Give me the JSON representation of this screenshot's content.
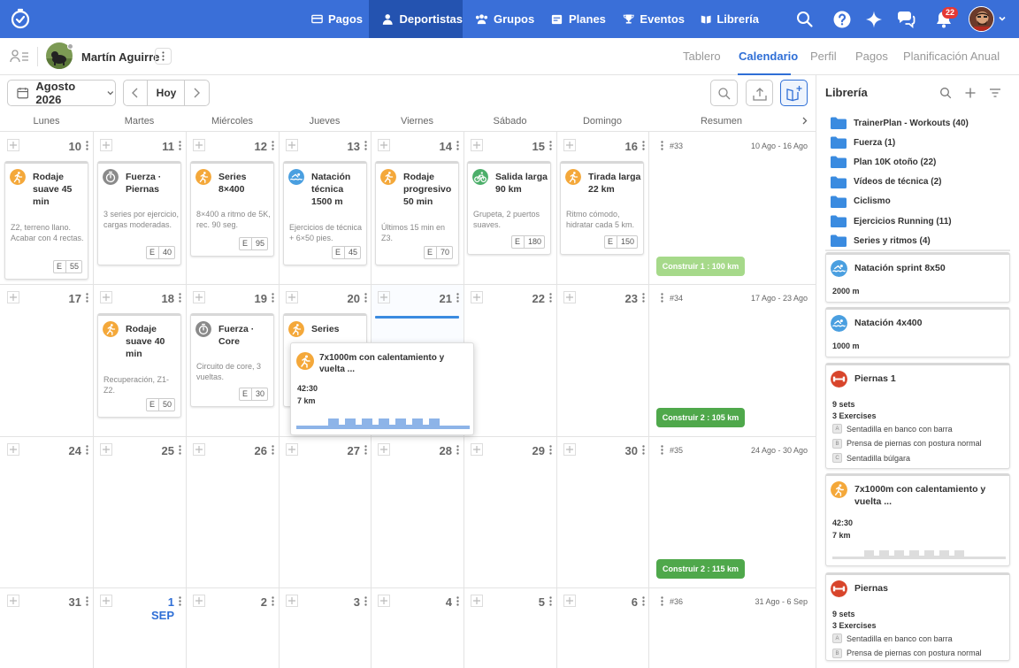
{
  "nav": {
    "items": [
      {
        "label": "Pagos",
        "icon": "card-icon"
      },
      {
        "label": "Deportistas",
        "icon": "person-icon"
      },
      {
        "label": "Grupos",
        "icon": "group-icon"
      },
      {
        "label": "Planes",
        "icon": "calendar-icon"
      },
      {
        "label": "Eventos",
        "icon": "trophy-icon"
      },
      {
        "label": "Librería",
        "icon": "book-icon"
      }
    ],
    "active": "Deportistas",
    "notifications": "22"
  },
  "athlete": {
    "name": "Martín Aguirre"
  },
  "tabs": [
    "Tablero",
    "Calendario",
    "Perfil",
    "Pagos",
    "Planificación Anual"
  ],
  "active_tab": "Calendario",
  "toolbar": {
    "month": "Agosto 2026",
    "today": "Hoy"
  },
  "calendar": {
    "day_headers": [
      "Lunes",
      "Martes",
      "Miércoles",
      "Jueves",
      "Viernes",
      "Sábado",
      "Domingo",
      "Resumen"
    ],
    "weeks": [
      {
        "days": [
          "10",
          "11",
          "12",
          "13",
          "14",
          "15",
          "16"
        ],
        "summary": {
          "week": "#33",
          "range": "10 Ago - 16 Ago",
          "badge": "Construir 1 : 100 km"
        }
      },
      {
        "days": [
          "17",
          "18",
          "19",
          "20",
          "21",
          "22",
          "23"
        ],
        "summary": {
          "week": "#34",
          "range": "17 Ago - 23 Ago",
          "badge": "Construir 2 : 105 km"
        }
      },
      {
        "days": [
          "24",
          "25",
          "26",
          "27",
          "28",
          "29",
          "30"
        ],
        "summary": {
          "week": "#35",
          "range": "24 Ago - 30 Ago",
          "badge": "Construir 2 : 115 km"
        }
      },
      {
        "days": [
          "31",
          "1 SEP",
          "2",
          "3",
          "4",
          "5",
          "6"
        ],
        "summary": {
          "week": "#36",
          "range": "31 Ago - 6 Sep",
          "badge": ""
        }
      }
    ],
    "workouts_week1": [
      {
        "title": "Rodaje suave 45 min",
        "desc": "Z2, terreno llano. Acabar con 4 rectas.",
        "e": "E",
        "val": "55",
        "type": "run"
      },
      {
        "title": "Fuerza · Piernas",
        "desc": "3 series por ejercicio, cargas moderadas.",
        "e": "E",
        "val": "40",
        "type": "strength"
      },
      {
        "title": "Series 8×400",
        "desc": "8×400 a ritmo de 5K, rec. 90 seg.",
        "e": "E",
        "val": "95",
        "type": "run"
      },
      {
        "title": "Natación técnica 1500 m",
        "desc": "Ejercicios de técnica + 6×50 pies.",
        "e": "E",
        "val": "45",
        "type": "swim"
      },
      {
        "title": "Rodaje progresivo 50 min",
        "desc": "Últimos 15 min en Z3.",
        "e": "E",
        "val": "70",
        "type": "run"
      },
      {
        "title": "Salida larga 90 km",
        "desc": "Grupeta, 2 puertos suaves.",
        "e": "E",
        "val": "180",
        "type": "bike"
      },
      {
        "title": "Tirada larga 22 km",
        "desc": "Ritmo cómodo, hidratar cada 5 km.",
        "e": "E",
        "val": "150",
        "type": "run"
      }
    ],
    "workouts_week2": [
      {
        "title": "Rodaje suave 40 min",
        "desc": "Recuperación, Z1-Z2.",
        "e": "E",
        "val": "50",
        "type": "run"
      },
      {
        "title": "Fuerza · Core",
        "desc": "Circuito de core, 3 vueltas.",
        "e": "E",
        "val": "30",
        "type": "strength"
      },
      {
        "title": "Series",
        "desc": "",
        "e": "",
        "val": "",
        "type": "run"
      }
    ],
    "popup": {
      "title": "7x1000m con calentamiento y vuelta ...",
      "time": "42:30",
      "distance": "7 km"
    }
  },
  "library": {
    "title": "Librería",
    "folders": [
      "TrainerPlan - Workouts (40)",
      "Fuerza (1)",
      "Plan 10K otoño (22)",
      "Vídeos de técnica (2)",
      "Ciclismo",
      "Ejercicios Running (11)",
      "Series y ritmos (4)"
    ],
    "cards": [
      {
        "title": "Natación sprint 8x50",
        "meta1": "2000 m",
        "type": "swim"
      },
      {
        "title": "Natación 4x400",
        "meta1": "1000 m",
        "type": "swim"
      },
      {
        "title": "Piernas 1",
        "meta1": "9 sets",
        "meta2": "3 Exercises",
        "exercises": [
          "Sentadilla en banco con barra",
          "Prensa de piernas con postura normal",
          "Sentadilla búlgara"
        ],
        "type": "gym"
      },
      {
        "title": "7x1000m con calentamiento y vuelta ...",
        "meta1": "42:30",
        "meta2": "7 km",
        "type": "run"
      },
      {
        "title": "Piernas",
        "meta1": "9 sets",
        "meta2": "3 Exercises",
        "exercises": [
          "Sentadilla en banco con barra",
          "Prensa de piernas con postura normal"
        ],
        "type": "gym"
      }
    ]
  },
  "colors": {
    "primary": "#3a6fd8",
    "active_nav": "#2453b0",
    "run": "#f4a83a",
    "swim": "#4a9fe0",
    "bike": "#4caf6a",
    "gym": "#d8452b",
    "strength": "#8a8a8a",
    "build1": "#a6d98a",
    "build2": "#4fa84b"
  }
}
